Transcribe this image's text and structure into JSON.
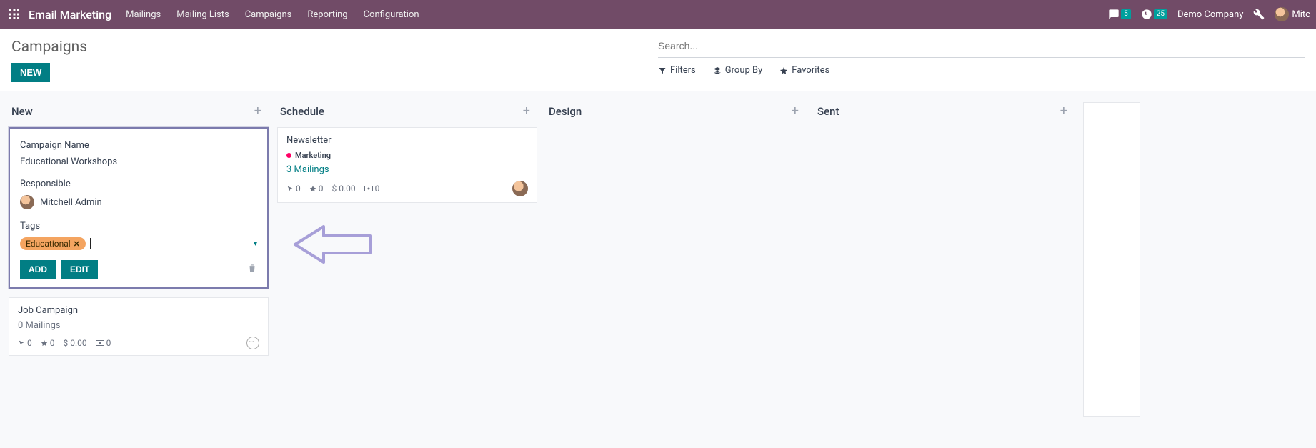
{
  "navbar": {
    "app_title": "Email Marketing",
    "links": [
      "Mailings",
      "Mailing Lists",
      "Campaigns",
      "Reporting",
      "Configuration"
    ],
    "messages_count": "5",
    "activities_count": "25",
    "company": "Demo Company",
    "user_short": "Mitc"
  },
  "control": {
    "title": "Campaigns",
    "new_btn": "NEW",
    "search_placeholder": "Search...",
    "filters": "Filters",
    "groupby": "Group By",
    "favorites": "Favorites"
  },
  "columns": {
    "new": {
      "title": "New"
    },
    "schedule": {
      "title": "Schedule"
    },
    "design": {
      "title": "Design"
    },
    "sent": {
      "title": "Sent"
    }
  },
  "quick_create": {
    "label_name": "Campaign Name",
    "value_name": "Educational Workshops",
    "label_resp": "Responsible",
    "value_resp": "Mitchell Admin",
    "label_tags": "Tags",
    "tag": "Educational",
    "add": "ADD",
    "edit": "EDIT"
  },
  "cards": {
    "job": {
      "title": "Job Campaign",
      "mailings": "0 Mailings",
      "clicks": "0",
      "leads": "0",
      "revenue": "$ 0.00",
      "quotes": "0"
    },
    "newsletter": {
      "title": "Newsletter",
      "tag": "Marketing",
      "mailings": "3 Mailings",
      "clicks": "0",
      "leads": "0",
      "revenue": "$ 0.00",
      "quotes": "0"
    }
  }
}
